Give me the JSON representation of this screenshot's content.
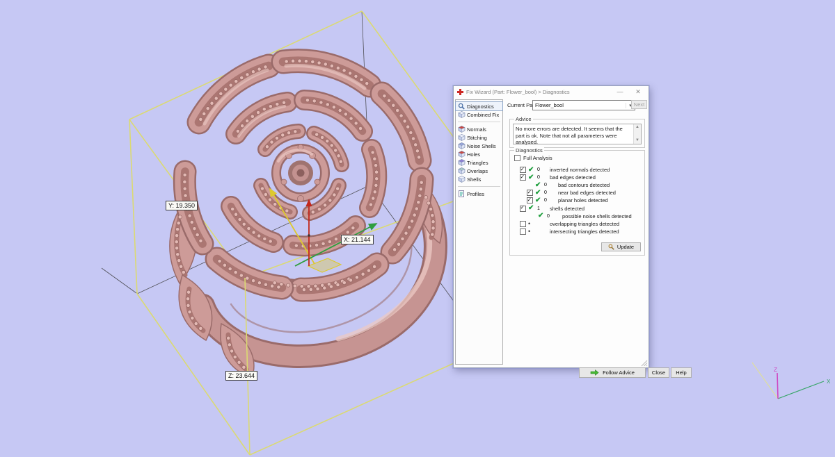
{
  "viewport": {
    "background_color": "#c6c8f4",
    "model_color": "#cd9b98",
    "bounding_box_color": "#dbda72",
    "measurements": {
      "x_label": "X: 21.144",
      "y_label": "Y: 19.350",
      "z_label": "Z: 23.644"
    },
    "axis_triad": {
      "x_label": "X",
      "z_label": "Z",
      "x_color": "#36a566",
      "z_color": "#cf46c1"
    }
  },
  "dialog": {
    "title": "Fix Wizard (Part: Flower_bool) > Diagnostics",
    "window_buttons": {
      "minimize": "—",
      "close": "✕"
    },
    "current_part": {
      "label": "Current Part:",
      "value": "Flower_bool",
      "next_label": "Next"
    },
    "sidebar": {
      "sections": [
        {
          "items": [
            {
              "label": "Diagnostics",
              "icon": "magnifier",
              "selected": true
            },
            {
              "label": "Combined Fix",
              "icon": "cube",
              "accent": "#eef1fb"
            }
          ]
        },
        {
          "items": [
            {
              "label": "Normals",
              "icon": "cube",
              "accent": "#c94a43"
            },
            {
              "label": "Stitching",
              "icon": "cube",
              "accent": "#eef1fb"
            },
            {
              "label": "Noise Shells",
              "icon": "cube",
              "accent": "#98a6d8"
            },
            {
              "label": "Holes",
              "icon": "cube",
              "accent": "#c94a43"
            },
            {
              "label": "Triangles",
              "icon": "cube",
              "accent": "#8d7fd4"
            },
            {
              "label": "Overlaps",
              "icon": "cube",
              "accent": "#a8c8c4"
            },
            {
              "label": "Shells",
              "icon": "cube",
              "accent": "#eef1fb"
            }
          ]
        },
        {
          "items": [
            {
              "label": "Profiles",
              "icon": "doc"
            }
          ]
        }
      ]
    },
    "advice": {
      "group_label": "Advice",
      "text": "No more errors are detected. It seems that the part is ok. Note that not all parameters were analysed."
    },
    "diagnostics": {
      "group_label": "Diagnostics",
      "full_analysis_label": "Full Analysis",
      "rows": [
        {
          "has_checkbox": true,
          "checked": true,
          "status": "check",
          "count": "0",
          "label": "inverted normals detected",
          "indent": 0
        },
        {
          "has_checkbox": true,
          "checked": true,
          "status": "check",
          "count": "0",
          "label": "bad edges detected",
          "indent": 0
        },
        {
          "has_checkbox": false,
          "checked": false,
          "status": "check",
          "count": "0",
          "label": "bad contours detected",
          "indent": 1
        },
        {
          "has_checkbox": true,
          "checked": true,
          "status": "check",
          "count": "0",
          "label": "near bad edges detected",
          "indent": 1
        },
        {
          "has_checkbox": true,
          "checked": true,
          "status": "check",
          "count": "0",
          "label": "planar holes detected",
          "indent": 1
        },
        {
          "has_checkbox": true,
          "checked": true,
          "status": "check",
          "count": "1",
          "label": "shells detected",
          "indent": 0
        },
        {
          "has_checkbox": false,
          "checked": false,
          "status": "check",
          "count": "0",
          "label": "possible noise shells detected",
          "indent": 2
        },
        {
          "has_checkbox": true,
          "checked": false,
          "status": "dot",
          "count": "",
          "label": "overlapping triangles detected",
          "indent": 0
        },
        {
          "has_checkbox": true,
          "checked": false,
          "status": "dot",
          "count": "",
          "label": "intersecting triangles detected",
          "indent": 0
        }
      ],
      "update_label": "Update"
    },
    "footer": {
      "follow_advice_label": "Follow Advice",
      "close_label": "Close",
      "help_label": "Help"
    }
  }
}
